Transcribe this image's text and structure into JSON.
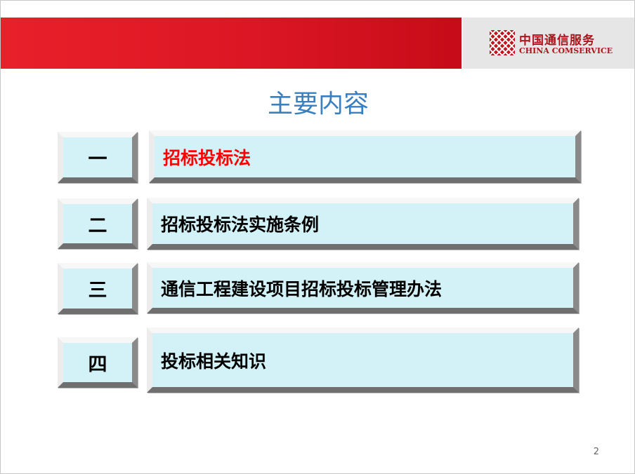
{
  "header": {
    "brand_cn": "中国通信服务",
    "brand_en": "CHINA COMSERVICE",
    "icon": "china-comservice-logo-icon",
    "band_color": "#e01b26"
  },
  "title": "主要内容",
  "items": [
    {
      "num": "一",
      "label": "招标投标法",
      "active": true
    },
    {
      "num": "二",
      "label": "招标投标法实施条例",
      "active": false
    },
    {
      "num": "三",
      "label": "通信工程建设项目招标投标管理办法",
      "active": false
    },
    {
      "num": "四",
      "label": "投标相关知识",
      "active": false
    }
  ],
  "colors": {
    "title": "#3a7fbf",
    "active_item": "#ff0000",
    "box_fill": "#d2f2f8"
  },
  "page_number": "2"
}
